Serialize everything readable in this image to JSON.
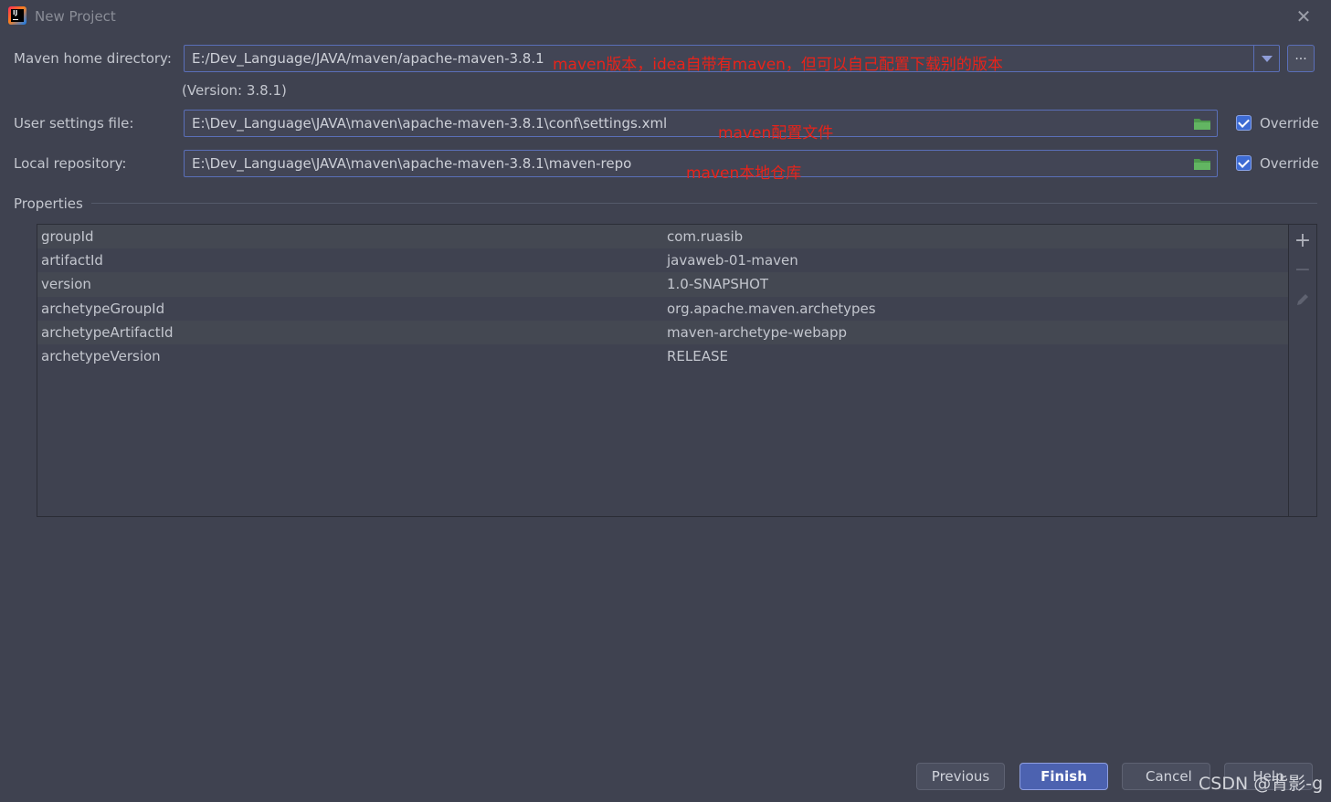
{
  "window": {
    "title": "New Project"
  },
  "form": {
    "maven_home": {
      "label": "Maven home directory:",
      "value": "E:/Dev_Language/JAVA/maven/apache-maven-3.8.1",
      "version_note": "(Version: 3.8.1)",
      "annotation": "maven版本，idea自带有maven，但可以自己配置下载别的版本",
      "browse_label": "..."
    },
    "user_settings": {
      "label": "User settings file:",
      "value": "E:\\Dev_Language\\JAVA\\maven\\apache-maven-3.8.1\\conf\\settings.xml",
      "annotation": "maven配置文件",
      "override_label": "Override",
      "override_checked": true
    },
    "local_repo": {
      "label": "Local repository:",
      "value": "E:\\Dev_Language\\JAVA\\maven\\apache-maven-3.8.1\\maven-repo",
      "annotation": "maven本地仓库",
      "override_label": "Override",
      "override_checked": true
    }
  },
  "properties": {
    "title": "Properties",
    "rows": [
      {
        "key": "groupId",
        "value": "com.ruasib"
      },
      {
        "key": "artifactId",
        "value": "javaweb-01-maven"
      },
      {
        "key": "version",
        "value": "1.0-SNAPSHOT"
      },
      {
        "key": "archetypeGroupId",
        "value": "org.apache.maven.archetypes"
      },
      {
        "key": "archetypeArtifactId",
        "value": "maven-archetype-webapp"
      },
      {
        "key": "archetypeVersion",
        "value": "RELEASE"
      }
    ],
    "toolbar": {
      "add": "+",
      "remove": "−"
    }
  },
  "buttons": {
    "previous": "Previous",
    "finish": "Finish",
    "cancel": "Cancel",
    "help": "Help"
  },
  "watermark": "CSDN @背影-g",
  "colors": {
    "accent": "#4c62b0",
    "annotation": "#e8231a",
    "background": "#3f4250"
  }
}
